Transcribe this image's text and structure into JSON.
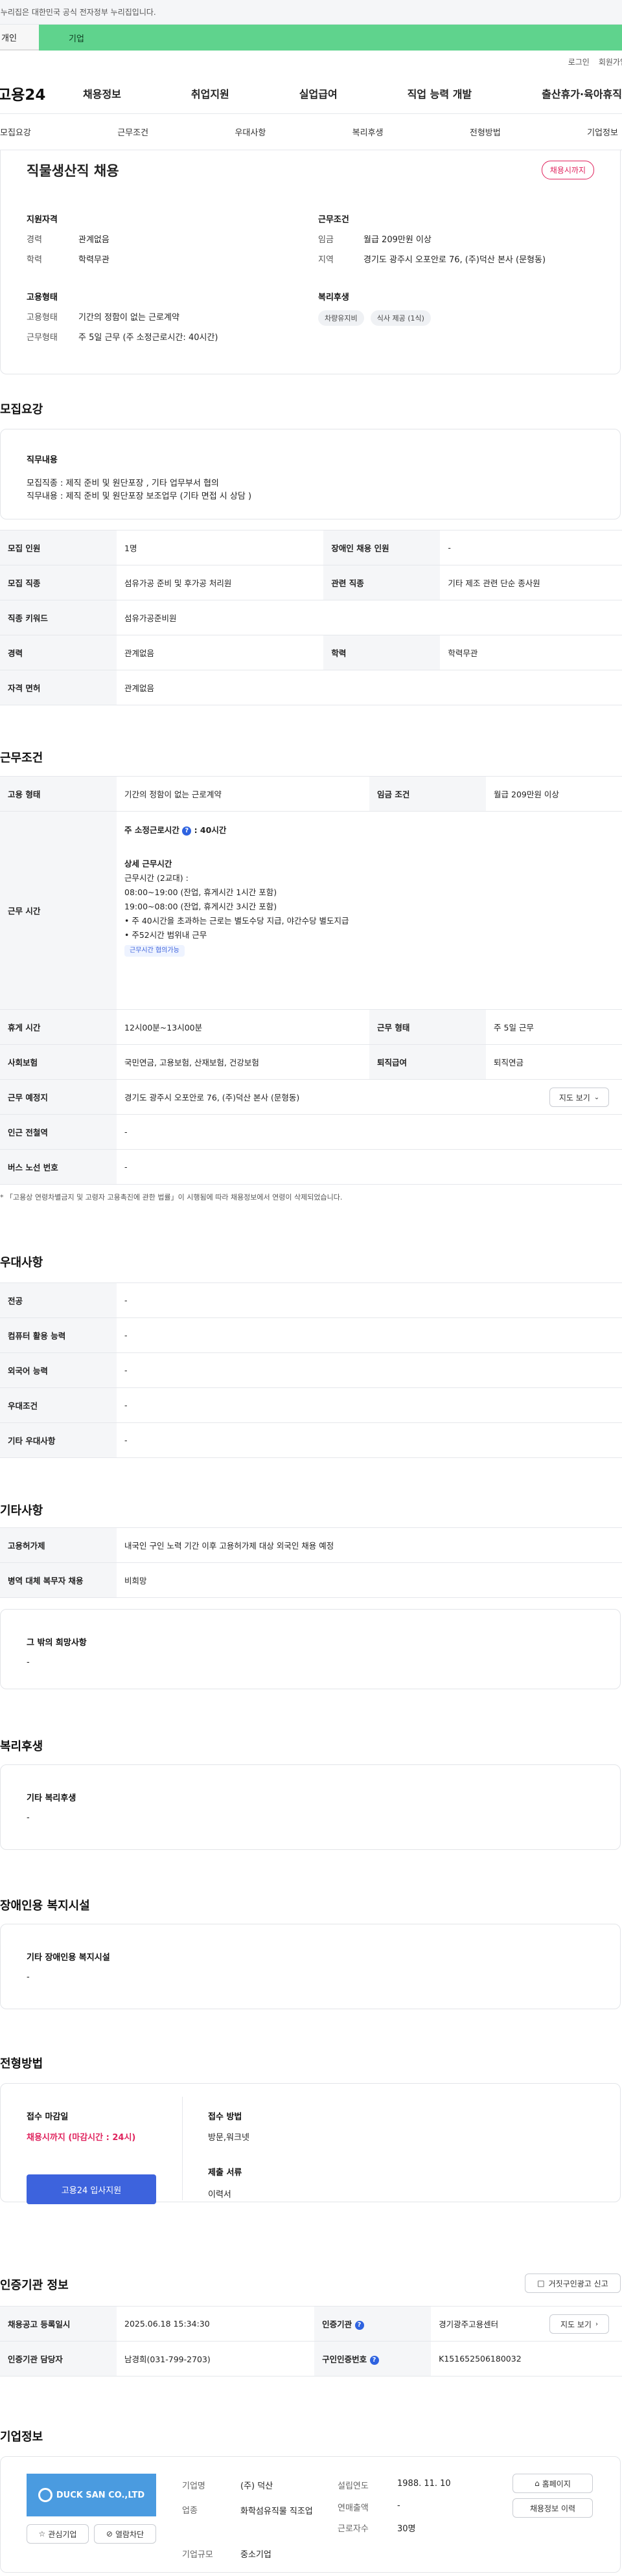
{
  "gov_banner": "이 누리집은 대한민국 공식 전자정부 누리집입니다.",
  "service_tabs": [
    "개인",
    "기업"
  ],
  "util_links": [
    "로그인",
    "회원가입"
  ],
  "logo": "고용24",
  "gnb": [
    "채용정보",
    "취업지원",
    "실업급여",
    "직업 능력 개발",
    "출산휴가·육아휴직"
  ],
  "snb": [
    "모집요강",
    "근무조건",
    "우대사항",
    "복리후생",
    "전형방법",
    "기업정보"
  ],
  "summary": {
    "title": "직물생산직 채용",
    "badge": "채용시까지",
    "qual_title": "지원자격",
    "qual": [
      {
        "k": "경력",
        "v": "관계없음"
      },
      {
        "k": "학력",
        "v": "학력무관"
      }
    ],
    "cond_title": "근무조건",
    "cond": [
      {
        "k": "임금",
        "v": "월급 209만원 이상"
      },
      {
        "k": "지역",
        "v": "경기도 광주시 오포안로 76, (주)덕산 본사 (문형동)"
      }
    ],
    "emp_title": "고용형태",
    "emp": [
      {
        "k": "고용형태",
        "v": "기간의 정함이 없는 근로계약"
      },
      {
        "k": "근무형태",
        "v": "주 5일 근무 (주 소정근로시간: 40시간)"
      }
    ],
    "welfare_title": "복리후생",
    "welfare_tags": [
      "차량유지비",
      "식사 제공 (1식)"
    ]
  },
  "recruit": {
    "title": "모집요강",
    "duty_title": "직무내용",
    "duty_lines": [
      "모집직종 : 제직 준비 및 원단포장 , 기타 업무부서 협의",
      "직무내용 : 제직 준비 및 원단포장 보조업무 (기타 면접 시 상담 )"
    ],
    "rows": [
      [
        "모집 인원",
        "1명",
        "장애인 채용 인원",
        "-"
      ],
      [
        "모집 직종",
        "섬유가공 준비 및 후가공 처리원",
        "관련 직종",
        "기타 제조 관련 단순 종사원"
      ],
      [
        "직종 키워드",
        "섬유가공준비원"
      ],
      [
        "경력",
        "관계없음",
        "학력",
        "학력무관"
      ],
      [
        "자격 면허",
        "관계없음"
      ]
    ]
  },
  "work": {
    "title": "근무조건",
    "row1": [
      "고용 형태",
      "기간의 정함이 없는 근로계약",
      "임금 조건",
      "월급 209만원 이상"
    ],
    "hours_label": "근무 시간",
    "hours_main": "주 소정근로시간",
    "hours_main_val": ": 40시간",
    "hours_detail_title": "상세 근무시간",
    "hours_lines": [
      "근무시간 (2교대) :",
      "08:00~19:00 (잔업, 휴게시간 1시간 포함)",
      "19:00~08:00 (잔업, 휴게시간 3시간 포함)",
      "• 주 40시간을 초과하는 근로는 별도수당 지급, 야간수당 별도지급",
      "• 주52시간 범위내 근무"
    ],
    "hours_tag": "근무시간 협의가능",
    "rows": [
      [
        "휴게 시간",
        "12시00분~13시00분",
        "근무 형태",
        "주 5일 근무"
      ],
      [
        "사회보험",
        "국민연금, 고용보험, 산재보험, 건강보험",
        "퇴직급여",
        "퇴직연금"
      ]
    ],
    "place_label": "근무 예정지",
    "place_val": "경기도 광주시 오포안로 76, (주)덕산 본사 (문형동)",
    "map_btn": "지도 보기",
    "station_label": "인근 전철역",
    "station_val": "-",
    "bus_label": "버스 노선 번호",
    "bus_val": "-",
    "note": "* 「고용상 연령차별금지 및 고령자 고용촉진에 관한 법률」이 시행됨에 따라 채용정보에서 연령이 삭제되었습니다."
  },
  "pref": {
    "title": "우대사항",
    "rows": [
      [
        "전공",
        "-"
      ],
      [
        "컴퓨터 활용 능력",
        "-"
      ],
      [
        "외국어 능력",
        "-"
      ],
      [
        "우대조건",
        "-"
      ],
      [
        "기타 우대사항",
        "-"
      ]
    ]
  },
  "etc": {
    "title": "기타사항",
    "rows": [
      [
        "고용허가제",
        "내국인 구인 노력 기간 이후 고용허가제 대상 외국인 채용 예정"
      ],
      [
        "병역 대체 복무자 채용",
        "비희망"
      ]
    ],
    "hope_title": "그 밖의 희망사항",
    "hope_val": "-"
  },
  "welfare": {
    "title": "복리후생",
    "sub": "기타 복리후생",
    "val": "-"
  },
  "disabled": {
    "title": "장애인용 복지시설",
    "sub": "기타 장애인용 복지시설",
    "val": "-"
  },
  "screening": {
    "title": "전형방법",
    "deadline_title": "접수 마감일",
    "deadline_val": "채용시까지 (마감시간 : 24시)",
    "apply_btn": "고용24 입사지원",
    "method_title": "접수 방법",
    "method_val": "방문,워크넷",
    "docs_title": "제출 서류",
    "docs_val": "이력서"
  },
  "cert": {
    "title": "인증기관 정보",
    "report_btn": "거짓구인광고 신고",
    "rows": [
      [
        "채용공고 등록일시",
        "2025.06.18 15:34:30",
        "인증기관",
        "경기광주고용센터"
      ],
      [
        "인증기관 담당자",
        "남경희(031-799-2703)",
        "구인인증번호",
        "K151652506180032"
      ]
    ],
    "map_btn": "지도 보기"
  },
  "company": {
    "title": "기업정보",
    "logo_text": "DUCK SAN CO.,LTD",
    "fav_btn": "관심기업",
    "block_btn": "열람차단",
    "name_k": "기업명",
    "name_v": "(주) 덕산",
    "ind_k": "업종",
    "ind_v": "화학섬유직물 직조업",
    "size_k": "기업규모",
    "size_v": "중소기업",
    "year_k": "설립연도",
    "year_v": "1988. 11. 10",
    "sales_k": "연매출액",
    "sales_v": "-",
    "emp_k": "근로자수",
    "emp_v": "30명",
    "home_btn": "홈페이지",
    "history_btn": "채용정보 이력"
  },
  "colors": {
    "green": "#5fd38d",
    "blue": "#3d63dd",
    "red": "#e0245e"
  }
}
